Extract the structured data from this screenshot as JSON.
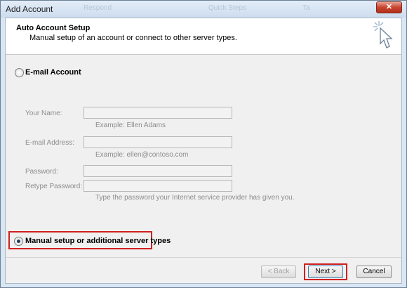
{
  "window": {
    "title": "Add Account",
    "background_titles": [
      "Respond",
      "Quick Steps",
      "Ta"
    ]
  },
  "header": {
    "title": "Auto Account Setup",
    "subtitle": "Manual setup of an account or connect to other server types."
  },
  "options": {
    "email_account": {
      "label": "E-mail Account",
      "selected": false
    },
    "manual_setup": {
      "label": "Manual setup or additional server types",
      "selected": true
    }
  },
  "form": {
    "name_label": "Your Name:",
    "name_value": "",
    "name_hint": "Example: Ellen Adams",
    "email_label": "E-mail Address:",
    "email_value": "",
    "email_hint": "Example: ellen@contoso.com",
    "password_label": "Password:",
    "password_value": "",
    "retype_label": "Retype Password:",
    "retype_value": "",
    "password_hint": "Type the password your Internet service provider has given you."
  },
  "buttons": {
    "back": "< Back",
    "next": "Next >",
    "cancel": "Cancel"
  },
  "colors": {
    "highlight": "#d21f1f",
    "close_button": "#c7442f"
  }
}
